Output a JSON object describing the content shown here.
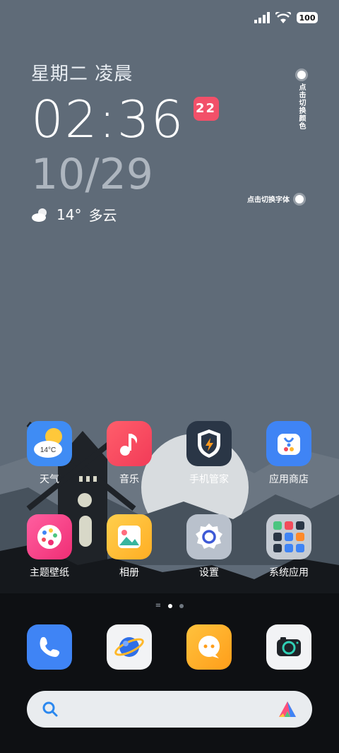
{
  "status": {
    "battery": "100"
  },
  "clock": {
    "dayline": "星期二 凌晨",
    "time": "02:36",
    "badge": "22",
    "date": "10/29"
  },
  "weather": {
    "temp": "14°",
    "condition": "多云"
  },
  "switch_color": {
    "label": "点击切换颜色"
  },
  "switch_font": {
    "label": "点击切换字体"
  },
  "apps": [
    {
      "label": "天气",
      "icon_text": "14°C"
    },
    {
      "label": "音乐"
    },
    {
      "label": "手机管家"
    },
    {
      "label": "应用商店"
    },
    {
      "label": "主题壁纸"
    },
    {
      "label": "相册"
    },
    {
      "label": "设置"
    },
    {
      "label": "系统应用"
    }
  ],
  "dock": [
    "phone-icon",
    "browser-icon",
    "messages-icon",
    "camera-icon"
  ],
  "colors": {
    "wallpaper_sky": "#5f6b78",
    "badge": "#f25069",
    "accent_blue": "#3f7ff0"
  }
}
